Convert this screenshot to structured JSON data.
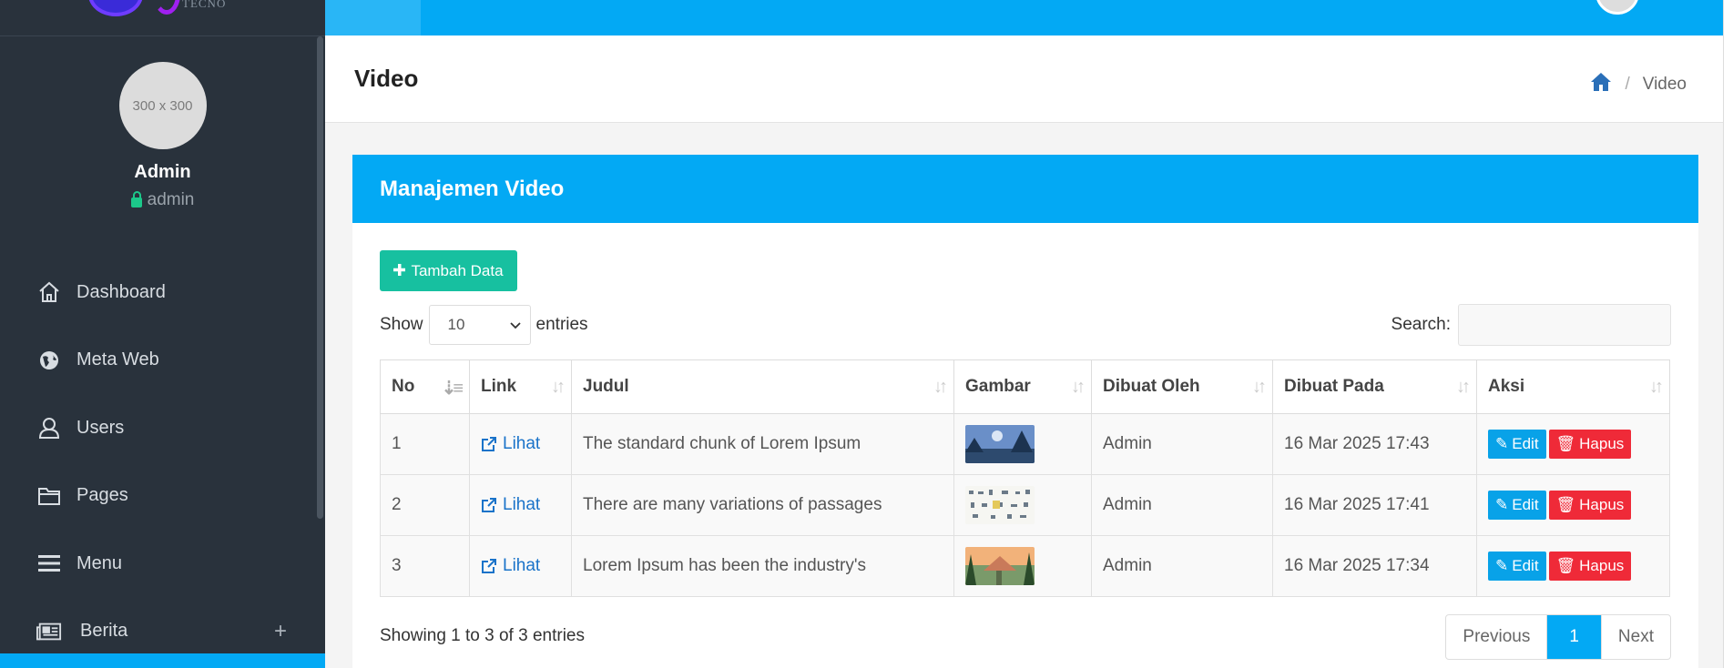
{
  "brand": {
    "text": "TECNO"
  },
  "profile": {
    "avatar_text": "300 x 300",
    "name": "Admin",
    "role": "admin"
  },
  "nav": [
    {
      "label": "Dashboard",
      "icon": "home-icon"
    },
    {
      "label": "Meta Web",
      "icon": "globe-icon"
    },
    {
      "label": "Users",
      "icon": "user-icon"
    },
    {
      "label": "Pages",
      "icon": "folder-icon"
    },
    {
      "label": "Menu",
      "icon": "bars-icon"
    },
    {
      "label": "Berita",
      "icon": "newspaper-icon",
      "expand": "+"
    }
  ],
  "header": {
    "title": "Video",
    "breadcrumb_current": "Video"
  },
  "card": {
    "title": "Manajemen Video",
    "add_label": "Tambah Data",
    "show_label": "Show",
    "length_value": "10",
    "entries_label": "entries",
    "search_label": "Search:"
  },
  "table": {
    "columns": [
      "No",
      "Link",
      "Judul",
      "Gambar",
      "Dibuat Oleh",
      "Dibuat Pada",
      "Aksi"
    ],
    "rows": [
      {
        "no": "1",
        "link": "Lihat",
        "judul": "The standard chunk of Lorem Ipsum",
        "by": "Admin",
        "at": "16 Mar 2025 17:43"
      },
      {
        "no": "2",
        "link": "Lihat",
        "judul": "There are many variations of passages",
        "by": "Admin",
        "at": "16 Mar 2025 17:41"
      },
      {
        "no": "3",
        "link": "Lihat",
        "judul": "Lorem Ipsum has been the industry's",
        "by": "Admin",
        "at": "16 Mar 2025 17:34"
      }
    ],
    "edit_label": "Edit",
    "delete_label": "Hapus"
  },
  "footer": {
    "info": "Showing 1 to 3 of 3 entries",
    "previous": "Previous",
    "current_page": "1",
    "next": "Next"
  },
  "colors": {
    "primary": "#03a9f4",
    "sidebar": "#29323c",
    "success": "#17c0a0",
    "danger": "#ef2a38"
  }
}
